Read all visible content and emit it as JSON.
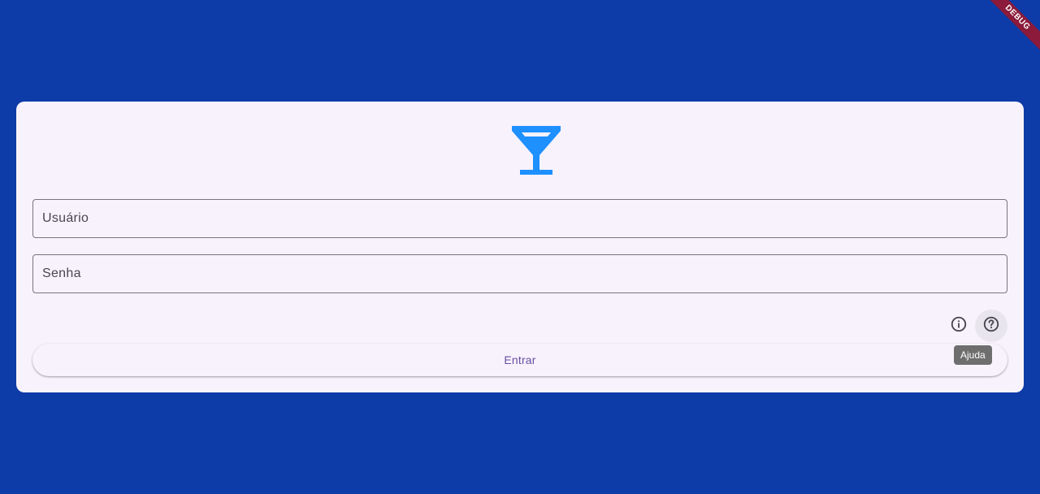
{
  "debug_banner": {
    "label": "DEBUG"
  },
  "logo": {
    "icon": "cocktail-glass-icon",
    "color": "#1e90ff"
  },
  "form": {
    "username": {
      "placeholder": "Usuário",
      "value": ""
    },
    "password": {
      "placeholder": "Senha",
      "value": ""
    }
  },
  "actions": {
    "info_icon": "info-icon",
    "help_icon": "help-icon",
    "help_tooltip": "Ajuda",
    "submit_label": "Entrar"
  },
  "colors": {
    "background": "#0d3ca8",
    "card": "#f8f2fc",
    "accent": "#6750a4",
    "logo": "#1e90ff"
  }
}
